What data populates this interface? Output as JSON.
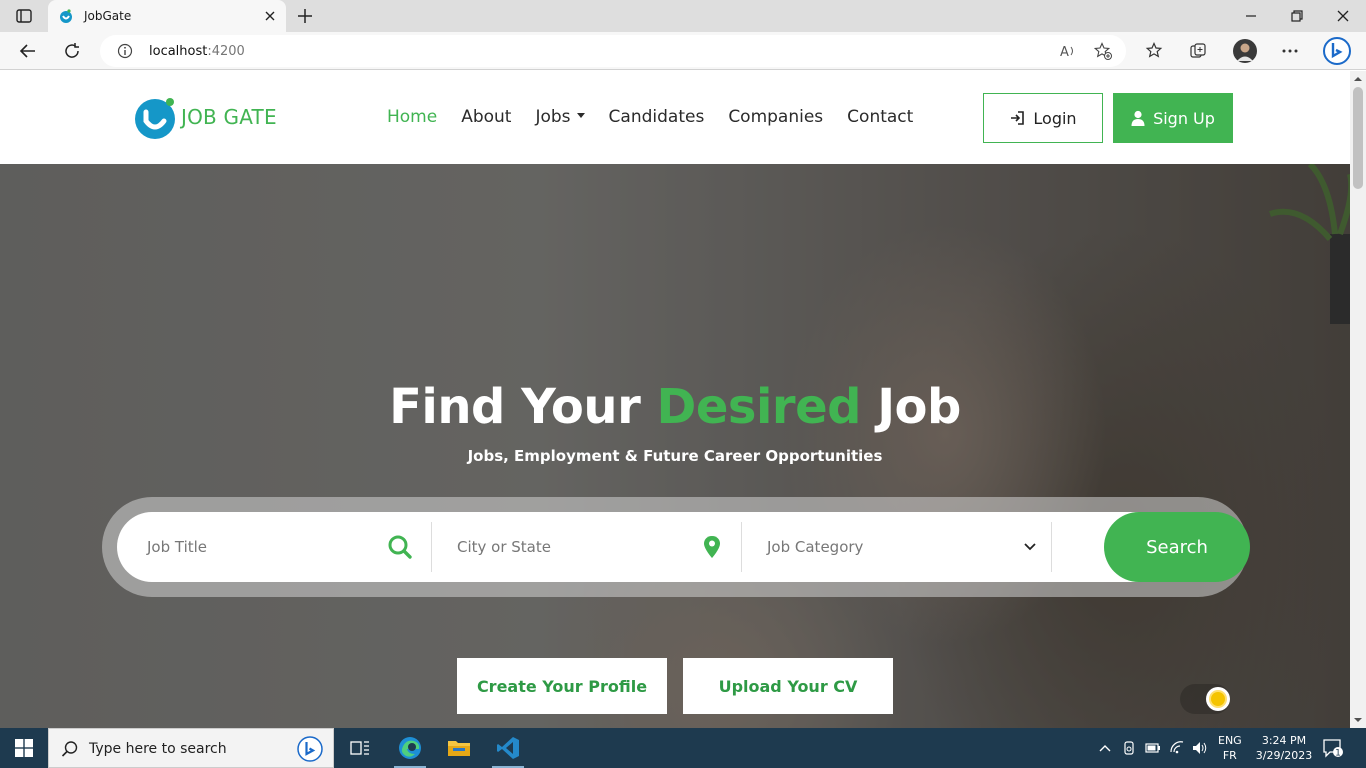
{
  "browser": {
    "tab_title": "JobGate",
    "address_host": "localhost",
    "address_port": ":4200"
  },
  "nav": {
    "logo_text": "JOB GATE",
    "links": [
      "Home",
      "About",
      "Jobs",
      "Candidates",
      "Companies",
      "Contact"
    ],
    "login_label": "Login",
    "signup_label": "Sign Up"
  },
  "hero": {
    "title_part1": "Find Your ",
    "title_accent": "Desired",
    "title_part2": " Job",
    "subtitle": "Jobs, Employment & Future Career Opportunities",
    "search": {
      "job_title_placeholder": "Job Title",
      "location_placeholder": "City or State",
      "category_placeholder": "Job Category",
      "button_label": "Search"
    },
    "cta_profile": "Create Your Profile",
    "cta_cv": "Upload Your CV"
  },
  "taskbar": {
    "search_placeholder": "Type here to search",
    "lang_top": "ENG",
    "lang_bottom": "FR",
    "time": "3:24 PM",
    "date": "3/29/2023",
    "notification_count": "1"
  },
  "colors": {
    "brand_green": "#41b452",
    "taskbar": "#1e3a4f"
  }
}
